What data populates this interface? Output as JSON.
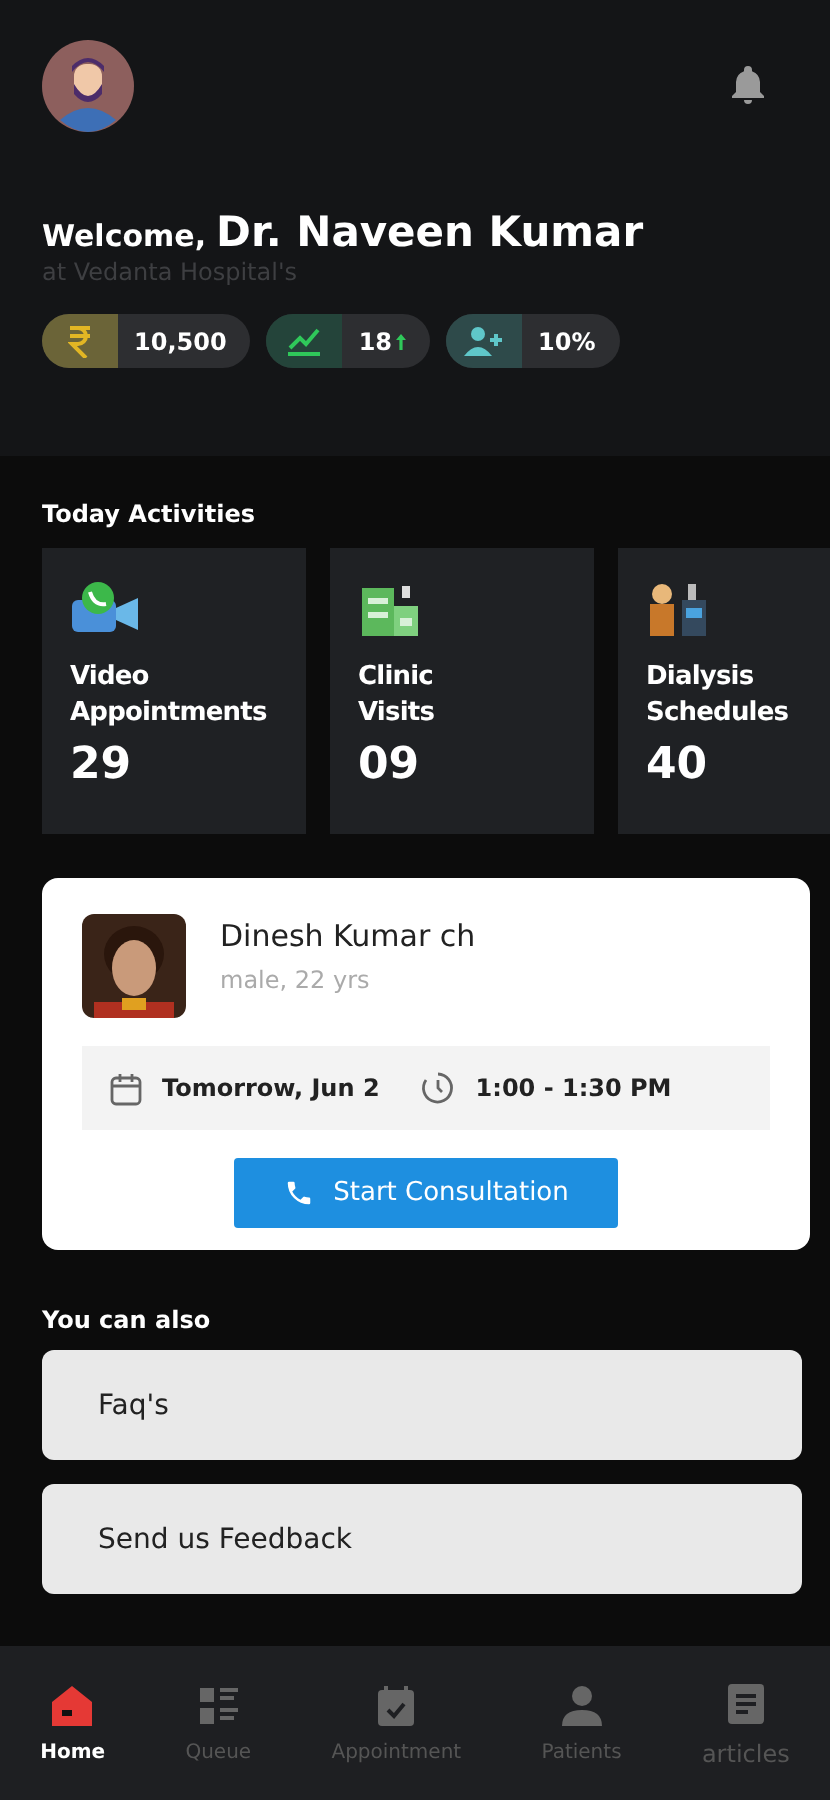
{
  "header": {
    "greeting": "Welcome,",
    "name": "Dr. Naveen Kumar",
    "subtitle": "at Vedanta Hospital's"
  },
  "stats": [
    {
      "kind": "revenue",
      "value": "10,500"
    },
    {
      "kind": "growth",
      "value": "18"
    },
    {
      "kind": "patients",
      "value": "10%"
    }
  ],
  "activities": {
    "title": "Today Activities",
    "cards": [
      {
        "kind": "video",
        "line1": "Video",
        "line2": "Appointments",
        "count": "29"
      },
      {
        "kind": "clinic",
        "line1": "Clinic",
        "line2": "Visits",
        "count": "09"
      },
      {
        "kind": "dialysis",
        "line1": "Dialysis",
        "line2": "Schedules",
        "count": "40"
      }
    ]
  },
  "appointment": {
    "patient": {
      "name": "Dinesh Kumar ch",
      "details": "male, 22 yrs"
    },
    "date": "Tomorrow, Jun 2",
    "time": "1:00 - 1:30 PM",
    "button": "Start Consultation"
  },
  "also": {
    "title": "You can also",
    "items": [
      "Faq's",
      "Send us Feedback"
    ]
  },
  "nav": [
    {
      "kind": "home",
      "label": "Home",
      "selected": true
    },
    {
      "kind": "queue",
      "label": "Queue",
      "selected": false
    },
    {
      "kind": "appointment",
      "label": "Appointment",
      "selected": false
    },
    {
      "kind": "patients",
      "label": "Patients",
      "selected": false
    },
    {
      "kind": "articles",
      "label": "articles",
      "selected": false
    }
  ]
}
